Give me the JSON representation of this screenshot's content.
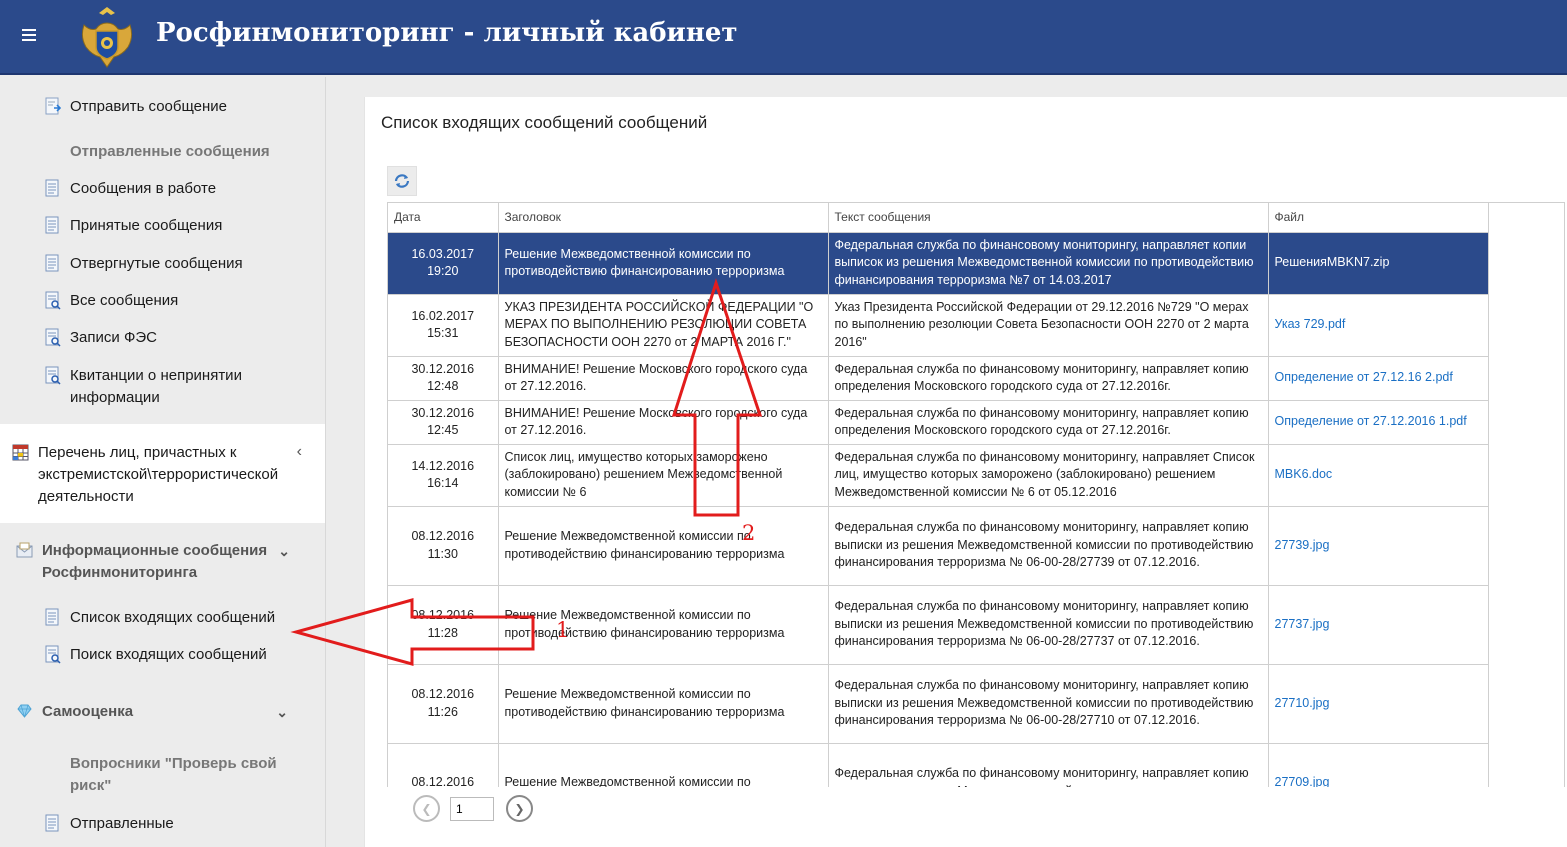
{
  "header": {
    "title": "Росфинмониторинг - личный кабинет"
  },
  "sidebar": {
    "items": [
      {
        "label": "Отправить сообщение"
      },
      {
        "label": "Отправленные сообщения"
      },
      {
        "label": "Сообщения в работе"
      },
      {
        "label": "Принятые сообщения"
      },
      {
        "label": "Отвергнутые сообщения"
      },
      {
        "label": "Все сообщения"
      },
      {
        "label": "Записи ФЭС"
      },
      {
        "label": "Квитанции о непринятии информации"
      },
      {
        "label": "Перечень лиц, причастных к экстремистской\\террористической деятельности"
      },
      {
        "label": "Информационные сообщения Росфинмониторинга"
      },
      {
        "label": "Список входящих сообщений"
      },
      {
        "label": "Поиск входящих сообщений"
      },
      {
        "label": "Самооценка"
      },
      {
        "label": "Вопросники \"Проверь свой риск\""
      },
      {
        "label": "Отправленные"
      }
    ]
  },
  "main": {
    "title": "Список входящих сообщений сообщений",
    "columns": [
      "Дата",
      "Заголовок",
      "Текст сообщения",
      "Файл"
    ],
    "rows": [
      {
        "date": "16.03.2017",
        "time": "19:20",
        "title": "Решение Межведомственной комиссии по противодействию финансированию терроризма",
        "text": "Федеральная служба по финансовому мониторингу, направляет копии выписок из решения Межведомственной комиссии по противодействию финансирования терроризма №7 от 14.03.2017",
        "file": "РешенияMBKN7.zip"
      },
      {
        "date": "16.02.2017",
        "time": "15:31",
        "title": "УКАЗ ПРЕЗИДЕНТА РОССИЙСКОЙ ФЕДЕРАЦИИ \"О МЕРАХ ПО ВЫПОЛНЕНИЮ РЕЗОЛЮЦИИ СОВЕТА БЕЗОПАСНОСТИ ООН 2270 от 2 МАРТА 2016 Г.\"",
        "text": "Указ Президента Российской Федерации от 29.12.2016 №729 \"О мерах по выполнению резолюции Совета Безопасности ООН 2270 от 2 марта 2016\"",
        "file": "Указ 729.pdf"
      },
      {
        "date": "30.12.2016",
        "time": "12:48",
        "title": "ВНИМАНИЕ! Решение Московского городского суда от 27.12.2016.",
        "text": "Федеральная служба по финансовому мониторингу, направляет копию определения Московского городского суда от 27.12.2016г.",
        "file": "Определение от 27.12.16 2.pdf"
      },
      {
        "date": "30.12.2016",
        "time": "12:45",
        "title": "ВНИМАНИЕ! Решение Московского городского суда от 27.12.2016.",
        "text": "Федеральная служба по финансовому мониторингу, направляет копию определения Московского городского суда от 27.12.2016г.",
        "file": "Определение от 27.12.2016 1.pdf"
      },
      {
        "date": "14.12.2016",
        "time": "16:14",
        "title": "Список лиц, имущество которых заморожено (заблокировано) решением Межведомственной комиссии № 6",
        "text": "Федеральная служба по финансовому мониторингу, направляет Список лиц, имущество которых заморожено (заблокировано) решением Межведомственной комиссии № 6 от 05.12.2016",
        "file": "MBK6.doc"
      },
      {
        "date": "08.12.2016",
        "time": "11:30",
        "title": "Решение Межведомственной комиссии по противодействию финансированию терроризма",
        "text": "Федеральная служба по финансовому мониторингу, направляет копию выписки из решения Межведомственной комиссии по противодействию финансирования терроризма № 06-00-28/27739 от 07.12.2016.",
        "file": "27739.jpg"
      },
      {
        "date": "08.12.2016",
        "time": "11:28",
        "title": "Решение Межведомственной комиссии по противодействию финансированию терроризма",
        "text": "Федеральная служба по финансовому мониторингу, направляет копию выписки из решения Межведомственной комиссии по противодействию финансирования терроризма № 06-00-28/27737 от 07.12.2016.",
        "file": "27737.jpg"
      },
      {
        "date": "08.12.2016",
        "time": "11:26",
        "title": "Решение Межведомственной комиссии по противодействию финансированию терроризма",
        "text": "Федеральная служба по финансовому мониторингу, направляет копию выписки из решения Межведомственной комиссии по противодействию финансирования терроризма № 06-00-28/27710 от 07.12.2016.",
        "file": "27710.jpg"
      },
      {
        "date": "08.12.2016",
        "time": "",
        "title": "Решение Межведомственной комиссии по",
        "text": "Федеральная служба по финансовому мониторингу, направляет копию выписки из решения Межведомственной комиссии по",
        "file": "27709.jpg"
      }
    ],
    "pager": {
      "page": "1"
    }
  },
  "annotations": {
    "arrow1_label": "1",
    "arrow2_label": "2"
  },
  "colors": {
    "header_bg": "#2b4a8b",
    "selected_row": "#2b4a8b",
    "link": "#1a6fc4",
    "annotation": "#e21c1c"
  }
}
